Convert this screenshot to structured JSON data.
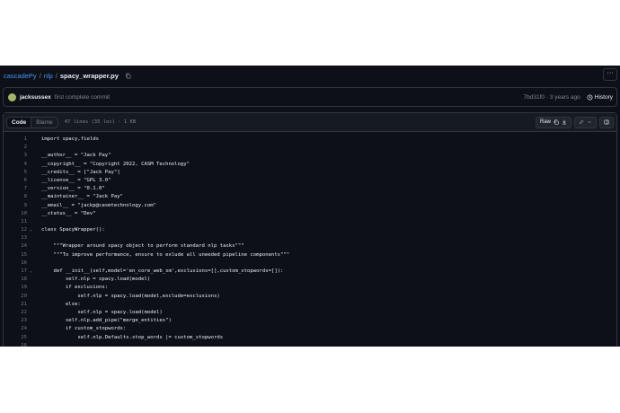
{
  "breadcrumb": {
    "repo": "cascadePy",
    "folder": "nlp",
    "file": "spacy_wrapper.py",
    "sep1": "/",
    "sep2": "/"
  },
  "commit": {
    "author": "jacksussex",
    "message": "first complete commit",
    "hash_time": "7bd31f0 · 3 years ago",
    "history_label": "History"
  },
  "file_header": {
    "tabs": [
      "Code",
      "Blame"
    ],
    "meta": "47 lines (35 loc) · 1 KB",
    "raw_label": "Raw"
  },
  "code_lines": [
    {
      "n": "1",
      "t": "import spacy,fields"
    },
    {
      "n": "2",
      "t": ""
    },
    {
      "n": "3",
      "t": "__author__ = \"Jack Pay\""
    },
    {
      "n": "4",
      "t": "__copyright__ = \"Copyright 2022, CASM Technology\""
    },
    {
      "n": "5",
      "t": "__credits__ = [\"Jack Pay\"]"
    },
    {
      "n": "6",
      "t": "__license__ = \"GPL 3.0\""
    },
    {
      "n": "7",
      "t": "__version__ = \"0.1.0\""
    },
    {
      "n": "8",
      "t": "__maintainer__ = \"Jack Pay\""
    },
    {
      "n": "9",
      "t": "__email__ = \"jackp@casmtechnology.com\""
    },
    {
      "n": "10",
      "t": "__status__ = \"Dev\""
    },
    {
      "n": "11",
      "t": ""
    },
    {
      "n": "12",
      "t": "class SpacyWrapper():"
    },
    {
      "n": "13",
      "t": ""
    },
    {
      "n": "14",
      "t": "    \"\"\"Wrapper around spacy object to perform standard nlp tasks\"\"\""
    },
    {
      "n": "15",
      "t": "    \"\"\"To improve performance, ensure to exlude all uneeded pipeline components\"\"\""
    },
    {
      "n": "16",
      "t": ""
    },
    {
      "n": "17",
      "t": "    def __init__(self,model='en_core_web_sm',exclusions=[],custom_stopwords=[]):"
    },
    {
      "n": "18",
      "t": "        self.nlp = spacy.load(model)"
    },
    {
      "n": "19",
      "t": "        if exclusions:"
    },
    {
      "n": "20",
      "t": "            self.nlp = spacy.load(model,exclude=exclusions)"
    },
    {
      "n": "21",
      "t": "        else:"
    },
    {
      "n": "22",
      "t": "            self.nlp = spacy.load(model)"
    },
    {
      "n": "23",
      "t": "        self.nlp.add_pipe(\"merge_entities\")"
    },
    {
      "n": "24",
      "t": "        if custom_stopwords:"
    },
    {
      "n": "25",
      "t": "            self.nlp.Defaults.stop_words |= custom_stopwords"
    },
    {
      "n": "26",
      "t": ""
    }
  ],
  "colors": {
    "bg": "#0d1117",
    "text": "#e6edf3",
    "muted": "#7d8590",
    "link": "#4493f8",
    "border": "#30363d"
  }
}
